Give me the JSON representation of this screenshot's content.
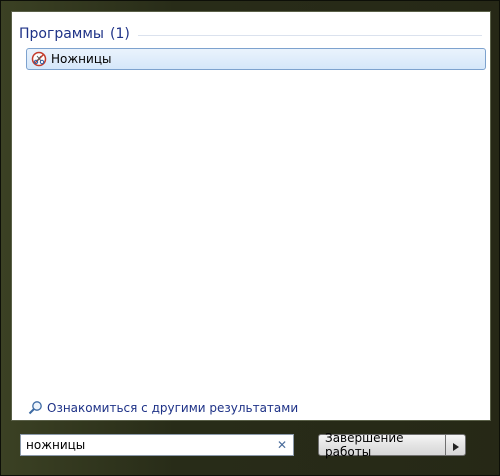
{
  "results": {
    "group_title": "Программы",
    "group_count": "(1)",
    "items": [
      {
        "label": "Ножницы",
        "icon": "snipping-tool-icon"
      }
    ]
  },
  "more_results": {
    "label": "Ознакомиться с другими результатами",
    "icon": "search-icon"
  },
  "search": {
    "value": "ножницы",
    "clear_icon": "clear-icon"
  },
  "shutdown": {
    "label": "Завершение работы",
    "arrow_icon": "arrow-right-icon"
  },
  "colors": {
    "accent_text": "#1e3287",
    "highlight_border": "#7da2ce",
    "highlight_bg": "#d5e7fa"
  }
}
